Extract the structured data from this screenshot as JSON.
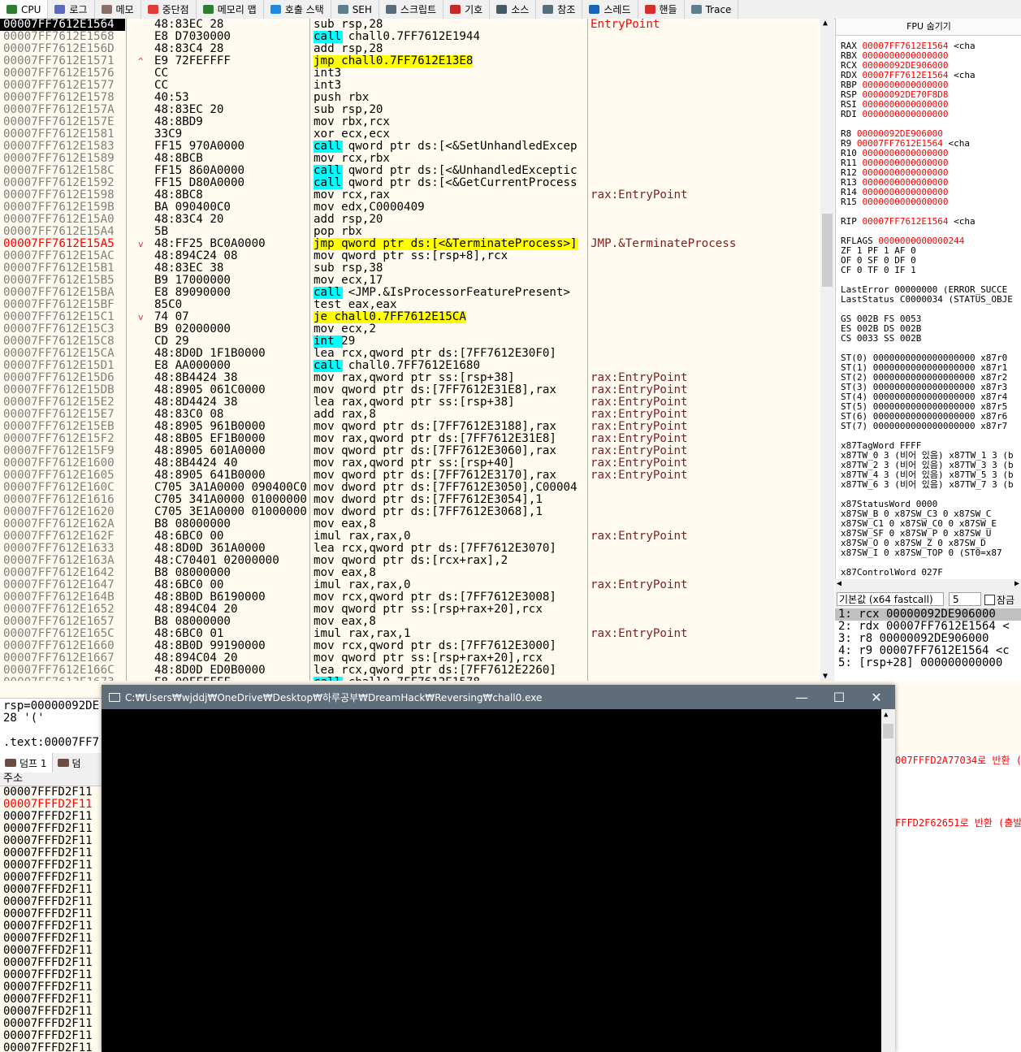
{
  "tabs": [
    {
      "label": "CPU",
      "icon": "cpu-icon",
      "color": "#2e7d32"
    },
    {
      "label": "로그",
      "icon": "log-icon",
      "color": "#5c6bc0"
    },
    {
      "label": "메모",
      "icon": "memo-icon",
      "color": "#8d6e63"
    },
    {
      "label": "중단점",
      "icon": "breakpoint-icon",
      "color": "#e53935"
    },
    {
      "label": "메모리 맵",
      "icon": "memory-map-icon",
      "color": "#2e7d32"
    },
    {
      "label": "호출 스택",
      "icon": "call-stack-icon",
      "color": "#1e88e5"
    },
    {
      "label": "SEH",
      "icon": "seh-icon",
      "color": "#607d8b"
    },
    {
      "label": "스크립트",
      "icon": "script-icon",
      "color": "#546e7a"
    },
    {
      "label": "기호",
      "icon": "symbol-icon",
      "color": "#c62828"
    },
    {
      "label": "소스",
      "icon": "source-icon",
      "color": "#455a64"
    },
    {
      "label": "참조",
      "icon": "search-icon",
      "color": "#546e7a"
    },
    {
      "label": "스레드",
      "icon": "thread-icon",
      "color": "#1565c0"
    },
    {
      "label": "핸들",
      "icon": "handle-icon",
      "color": "#d32f2f"
    },
    {
      "label": "Trace",
      "icon": "trace-icon",
      "color": "#607d8b"
    }
  ],
  "disasm": [
    {
      "addr": "00007FF7612E1564",
      "bytes": "48:83EC 28",
      "instr": "sub rsp,28",
      "cmt": "EntryPoint",
      "sel": true
    },
    {
      "addr": "00007FF7612E1568",
      "bytes": "E8 D7030000",
      "instr": "call chall0.7FF7612E1944",
      "cmt": "",
      "hl": "call"
    },
    {
      "addr": "00007FF7612E156D",
      "bytes": "48:83C4 28",
      "instr": "add rsp,28",
      "cmt": ""
    },
    {
      "addr": "00007FF7612E1571",
      "arrow": "^",
      "bytes": "E9 72FEFFFF",
      "instr": "jmp chall0.7FF7612E13E8",
      "cmt": "",
      "hl": "jmp"
    },
    {
      "addr": "00007FF7612E1576",
      "bytes": "CC",
      "instr": "int3",
      "cmt": ""
    },
    {
      "addr": "00007FF7612E1577",
      "bytes": "CC",
      "instr": "int3",
      "cmt": ""
    },
    {
      "addr": "00007FF7612E1578",
      "bytes": "40:53",
      "instr": "push rbx",
      "cmt": ""
    },
    {
      "addr": "00007FF7612E157A",
      "bytes": "48:83EC 20",
      "instr": "sub rsp,20",
      "cmt": ""
    },
    {
      "addr": "00007FF7612E157E",
      "bytes": "48:8BD9",
      "instr": "mov rbx,rcx",
      "cmt": ""
    },
    {
      "addr": "00007FF7612E1581",
      "bytes": "33C9",
      "instr": "xor ecx,ecx",
      "cmt": ""
    },
    {
      "addr": "00007FF7612E1583",
      "bytes": "FF15 970A0000",
      "instr": "call qword ptr ds:[<&SetUnhandledExcep",
      "cmt": "",
      "hl": "call"
    },
    {
      "addr": "00007FF7612E1589",
      "bytes": "48:8BCB",
      "instr": "mov rcx,rbx",
      "cmt": ""
    },
    {
      "addr": "00007FF7612E158C",
      "bytes": "FF15 860A0000",
      "instr": "call qword ptr ds:[<&UnhandledExceptic",
      "cmt": "",
      "hl": "call"
    },
    {
      "addr": "00007FF7612E1592",
      "bytes": "FF15 D80A0000",
      "instr": "call qword ptr ds:[<&GetCurrentProcess",
      "cmt": "",
      "hl": "call"
    },
    {
      "addr": "00007FF7612E1598",
      "bytes": "48:8BC8",
      "instr": "mov rcx,rax",
      "cmt": "rax:EntryPoint"
    },
    {
      "addr": "00007FF7612E159B",
      "bytes": "BA 090400C0",
      "instr": "mov edx,C0000409",
      "cmt": ""
    },
    {
      "addr": "00007FF7612E15A0",
      "bytes": "48:83C4 20",
      "instr": "add rsp,20",
      "cmt": ""
    },
    {
      "addr": "00007FF7612E15A4",
      "bytes": "5B",
      "instr": "pop rbx",
      "cmt": ""
    },
    {
      "addr": "00007FF7612E15A5",
      "arrow": "v",
      "bytes": "48:FF25 BC0A0000",
      "instr": "jmp qword ptr ds:[<&TerminateProcess>]",
      "cmt": "JMP.&TerminateProcess",
      "bp": true,
      "hl": "jmp"
    },
    {
      "addr": "00007FF7612E15AC",
      "bytes": "48:894C24 08",
      "instr": "mov qword ptr ss:[rsp+8],rcx",
      "cmt": ""
    },
    {
      "addr": "00007FF7612E15B1",
      "bytes": "48:83EC 38",
      "instr": "sub rsp,38",
      "cmt": ""
    },
    {
      "addr": "00007FF7612E15B5",
      "bytes": "B9 17000000",
      "instr": "mov ecx,17",
      "cmt": ""
    },
    {
      "addr": "00007FF7612E15BA",
      "bytes": "E8 89090000",
      "instr": "call <JMP.&IsProcessorFeaturePresent>",
      "cmt": "",
      "hl": "call"
    },
    {
      "addr": "00007FF7612E15BF",
      "bytes": "85C0",
      "instr": "test eax,eax",
      "cmt": ""
    },
    {
      "addr": "00007FF7612E15C1",
      "arrow": "v",
      "bytes": "74 07",
      "instr": "je chall0.7FF7612E15CA",
      "cmt": "",
      "hl": "jmp"
    },
    {
      "addr": "00007FF7612E15C3",
      "bytes": "B9 02000000",
      "instr": "mov ecx,2",
      "cmt": ""
    },
    {
      "addr": "00007FF7612E15C8",
      "bytes": "CD 29",
      "instr": "int 29",
      "cmt": "",
      "hl": "int"
    },
    {
      "addr": "00007FF7612E15CA",
      "bytes": "48:8D0D 1F1B0000",
      "instr": "lea rcx,qword ptr ds:[7FF7612E30F0]",
      "cmt": ""
    },
    {
      "addr": "00007FF7612E15D1",
      "bytes": "E8 AA000000",
      "instr": "call chall0.7FF7612E1680",
      "cmt": "",
      "hl": "call"
    },
    {
      "addr": "00007FF7612E15D6",
      "bytes": "48:8B4424 38",
      "instr": "mov rax,qword ptr ss:[rsp+38]",
      "cmt": "rax:EntryPoint"
    },
    {
      "addr": "00007FF7612E15DB",
      "bytes": "48:8905 061C0000",
      "instr": "mov qword ptr ds:[7FF7612E31E8],rax",
      "cmt": "rax:EntryPoint"
    },
    {
      "addr": "00007FF7612E15E2",
      "bytes": "48:8D4424 38",
      "instr": "lea rax,qword ptr ss:[rsp+38]",
      "cmt": "rax:EntryPoint"
    },
    {
      "addr": "00007FF7612E15E7",
      "bytes": "48:83C0 08",
      "instr": "add rax,8",
      "cmt": "rax:EntryPoint"
    },
    {
      "addr": "00007FF7612E15EB",
      "bytes": "48:8905 961B0000",
      "instr": "mov qword ptr ds:[7FF7612E3188],rax",
      "cmt": "rax:EntryPoint"
    },
    {
      "addr": "00007FF7612E15F2",
      "bytes": "48:8B05 EF1B0000",
      "instr": "mov rax,qword ptr ds:[7FF7612E31E8]",
      "cmt": "rax:EntryPoint"
    },
    {
      "addr": "00007FF7612E15F9",
      "bytes": "48:8905 601A0000",
      "instr": "mov qword ptr ds:[7FF7612E3060],rax",
      "cmt": "rax:EntryPoint"
    },
    {
      "addr": "00007FF7612E1600",
      "bytes": "48:8B4424 40",
      "instr": "mov rax,qword ptr ss:[rsp+40]",
      "cmt": "rax:EntryPoint"
    },
    {
      "addr": "00007FF7612E1605",
      "bytes": "48:8905 641B0000",
      "instr": "mov qword ptr ds:[7FF7612E3170],rax",
      "cmt": "rax:EntryPoint"
    },
    {
      "addr": "00007FF7612E160C",
      "bytes": "C705 3A1A0000 090400C0",
      "instr": "mov dword ptr ds:[7FF7612E3050],C00004",
      "cmt": ""
    },
    {
      "addr": "00007FF7612E1616",
      "bytes": "C705 341A0000 01000000",
      "instr": "mov dword ptr ds:[7FF7612E3054],1",
      "cmt": ""
    },
    {
      "addr": "00007FF7612E1620",
      "bytes": "C705 3E1A0000 01000000",
      "instr": "mov dword ptr ds:[7FF7612E3068],1",
      "cmt": ""
    },
    {
      "addr": "00007FF7612E162A",
      "bytes": "B8 08000000",
      "instr": "mov eax,8",
      "cmt": ""
    },
    {
      "addr": "00007FF7612E162F",
      "bytes": "48:6BC0 00",
      "instr": "imul rax,rax,0",
      "cmt": "rax:EntryPoint"
    },
    {
      "addr": "00007FF7612E1633",
      "bytes": "48:8D0D 361A0000",
      "instr": "lea rcx,qword ptr ds:[7FF7612E3070]",
      "cmt": ""
    },
    {
      "addr": "00007FF7612E163A",
      "bytes": "48:C70401 02000000",
      "instr": "mov qword ptr ds:[rcx+rax],2",
      "cmt": ""
    },
    {
      "addr": "00007FF7612E1642",
      "bytes": "B8 08000000",
      "instr": "mov eax,8",
      "cmt": ""
    },
    {
      "addr": "00007FF7612E1647",
      "bytes": "48:6BC0 00",
      "instr": "imul rax,rax,0",
      "cmt": "rax:EntryPoint"
    },
    {
      "addr": "00007FF7612E164B",
      "bytes": "48:8B0D B6190000",
      "instr": "mov rcx,qword ptr ds:[7FF7612E3008]",
      "cmt": ""
    },
    {
      "addr": "00007FF7612E1652",
      "bytes": "48:894C04 20",
      "instr": "mov qword ptr ss:[rsp+rax+20],rcx",
      "cmt": ""
    },
    {
      "addr": "00007FF7612E1657",
      "bytes": "B8 08000000",
      "instr": "mov eax,8",
      "cmt": ""
    },
    {
      "addr": "00007FF7612E165C",
      "bytes": "48:6BC0 01",
      "instr": "imul rax,rax,1",
      "cmt": "rax:EntryPoint"
    },
    {
      "addr": "00007FF7612E1660",
      "bytes": "48:8B0D 99190000",
      "instr": "mov rcx,qword ptr ds:[7FF7612E3000]",
      "cmt": ""
    },
    {
      "addr": "00007FF7612E1667",
      "bytes": "48:894C04 20",
      "instr": "mov qword ptr ss:[rsp+rax+20],rcx",
      "cmt": ""
    },
    {
      "addr": "00007FF7612E166C",
      "bytes": "48:8D0D ED0B0000",
      "instr": "lea rcx,qword ptr ds:[7FF7612E2260]",
      "cmt": ""
    },
    {
      "addr": "00007FF7612E1673",
      "bytes": "E8 00FFFFFF",
      "instr": "call chall0.7FF7612E1578",
      "cmt": "",
      "hl": "call"
    }
  ],
  "registers": {
    "header": "FPU 숨기기",
    "lines": [
      {
        "t": "RAX     00007FF7612E1564     <cha",
        "r": true
      },
      {
        "t": "RBX     0000000000000000",
        "r": true
      },
      {
        "t": "RCX     00000092DE906000",
        "r": true
      },
      {
        "t": "RDX     00007FF7612E1564     <cha",
        "r": true
      },
      {
        "t": "RBP     0000000000000000",
        "r": true
      },
      {
        "t": "RSP     00000092DE70F8D8",
        "r": true
      },
      {
        "t": "RSI     0000000000000000",
        "r": true
      },
      {
        "t": "RDI     0000000000000000",
        "r": true
      },
      {
        "t": "",
        "r": false
      },
      {
        "t": "R8      00000092DE906000",
        "r": true
      },
      {
        "t": "R9      00007FF7612E1564     <cha",
        "r": true
      },
      {
        "t": "R10     0000000000000000",
        "r": true
      },
      {
        "t": "R11     0000000000000000",
        "r": true
      },
      {
        "t": "R12     0000000000000000",
        "r": true
      },
      {
        "t": "R13     0000000000000000",
        "r": true
      },
      {
        "t": "R14     0000000000000000",
        "r": true
      },
      {
        "t": "R15     0000000000000000",
        "r": true
      },
      {
        "t": "",
        "r": false
      },
      {
        "t": "RIP     00007FF7612E1564     <cha",
        "r": true
      },
      {
        "t": "",
        "r": false
      },
      {
        "t": "RFLAGS   0000000000000244",
        "r": true
      },
      {
        "t": "ZF 1  PF 1  AF 0",
        "r": false
      },
      {
        "t": "OF 0  SF 0  DF 0",
        "r": false
      },
      {
        "t": "CF 0  TF 0  IF 1",
        "r": false
      },
      {
        "t": "",
        "r": false
      },
      {
        "t": "LastError  00000000 (ERROR_SUCCE",
        "r": false
      },
      {
        "t": "LastStatus C0000034 (STATUS_OBJE",
        "r": false
      },
      {
        "t": "",
        "r": false
      },
      {
        "t": "GS 002B  FS 0053",
        "r": false
      },
      {
        "t": "ES 002B  DS 002B",
        "r": false
      },
      {
        "t": "CS 0033  SS 002B",
        "r": false
      },
      {
        "t": "",
        "r": false
      },
      {
        "t": "ST(0) 0000000000000000000 x87r0",
        "r": false
      },
      {
        "t": "ST(1) 0000000000000000000 x87r1",
        "r": false
      },
      {
        "t": "ST(2) 0000000000000000000 x87r2",
        "r": false
      },
      {
        "t": "ST(3) 0000000000000000000 x87r3",
        "r": false
      },
      {
        "t": "ST(4) 0000000000000000000 x87r4",
        "r": false
      },
      {
        "t": "ST(5) 0000000000000000000 x87r5",
        "r": false
      },
      {
        "t": "ST(6) 0000000000000000000 x87r6",
        "r": false
      },
      {
        "t": "ST(7) 0000000000000000000 x87r7",
        "r": false
      },
      {
        "t": "",
        "r": false
      },
      {
        "t": "x87TagWord FFFF",
        "r": false
      },
      {
        "t": "x87TW_0 3 (비어 있음) x87TW_1 3 (b",
        "r": false
      },
      {
        "t": "x87TW_2 3 (비어 있음) x87TW_3 3 (b",
        "r": false
      },
      {
        "t": "x87TW_4 3 (비어 있음) x87TW_5 3 (b",
        "r": false
      },
      {
        "t": "x87TW_6 3 (비어 있음) x87TW_7 3 (b",
        "r": false
      },
      {
        "t": "",
        "r": false
      },
      {
        "t": "x87StatusWord 0000",
        "r": false
      },
      {
        "t": "x87SW_B  0  x87SW_C3  0  x87SW_C",
        "r": false
      },
      {
        "t": "x87SW_C1 0  x87SW_C0  0  x87SW_E",
        "r": false
      },
      {
        "t": "x87SW_SF 0  x87SW_P   0  x87SW_U",
        "r": false
      },
      {
        "t": "x87SW_O  0  x87SW_Z   0  x87SW_D",
        "r": false
      },
      {
        "t": "x87SW_I  0  x87SW_TOP 0 (ST0=x87",
        "r": false
      },
      {
        "t": "",
        "r": false
      },
      {
        "t": "x87ControlWord 027F",
        "r": false
      }
    ]
  },
  "callconv": {
    "label": "기본값 (x64 fastcall)",
    "count": "5",
    "lock_label": "잠금",
    "lines": [
      "1: rcx 00000092DE906000",
      "2: rdx 00007FF7612E1564 <",
      "3: r8 00000092DE906000",
      "4: r9 00007FF7612E1564 <c",
      "5: [rsp+28] 000000000000"
    ]
  },
  "info": {
    "line1": "rsp=00000092DE",
    "line2": "28 '('",
    "line3": ".text:00007FF7"
  },
  "dump": {
    "tab1": "덤프 1",
    "tab2": "덤",
    "header": "주소",
    "lines": [
      {
        "t": "00007FFFD2F11",
        "r": false
      },
      {
        "t": "00007FFFD2F11",
        "r": true
      },
      {
        "t": "00007FFFD2F11",
        "r": false
      },
      {
        "t": "00007FFFD2F11",
        "r": false
      },
      {
        "t": "00007FFFD2F11",
        "r": false
      },
      {
        "t": "00007FFFD2F11",
        "r": false
      },
      {
        "t": "00007FFFD2F11",
        "r": false
      },
      {
        "t": "00007FFFD2F11",
        "r": false
      },
      {
        "t": "00007FFFD2F11",
        "r": false
      },
      {
        "t": "00007FFFD2F11",
        "r": false
      },
      {
        "t": "00007FFFD2F11",
        "r": false
      },
      {
        "t": "00007FFFD2F11",
        "r": false
      },
      {
        "t": "00007FFFD2F11",
        "r": false
      },
      {
        "t": "00007FFFD2F11",
        "r": false
      },
      {
        "t": "00007FFFD2F11",
        "r": false
      },
      {
        "t": "00007FFFD2F11",
        "r": false
      },
      {
        "t": "00007FFFD2F11",
        "r": false
      },
      {
        "t": "00007FFFD2F11",
        "r": false
      },
      {
        "t": "00007FFFD2F11",
        "r": false
      },
      {
        "t": "00007FFFD2F11",
        "r": false
      },
      {
        "t": "00007FFFD2F11",
        "r": false
      },
      {
        "t": "00007FFFD2F11",
        "r": false
      }
    ]
  },
  "log": {
    "line1": "007FFFD2A77034로 반환 (",
    "line2": "FFFD2F62651로 반환 (출발"
  },
  "console": {
    "title": "C:₩Users₩wjddj₩OneDrive₩Desktop₩하루공부₩DreamHack₩Reversing₩chall0.exe",
    "min": "—",
    "max": "☐",
    "close": "✕"
  },
  "colors": {
    "call_bg": "#00ffff",
    "jmp_bg": "#ffff00",
    "reg_color": "#ff0000"
  }
}
